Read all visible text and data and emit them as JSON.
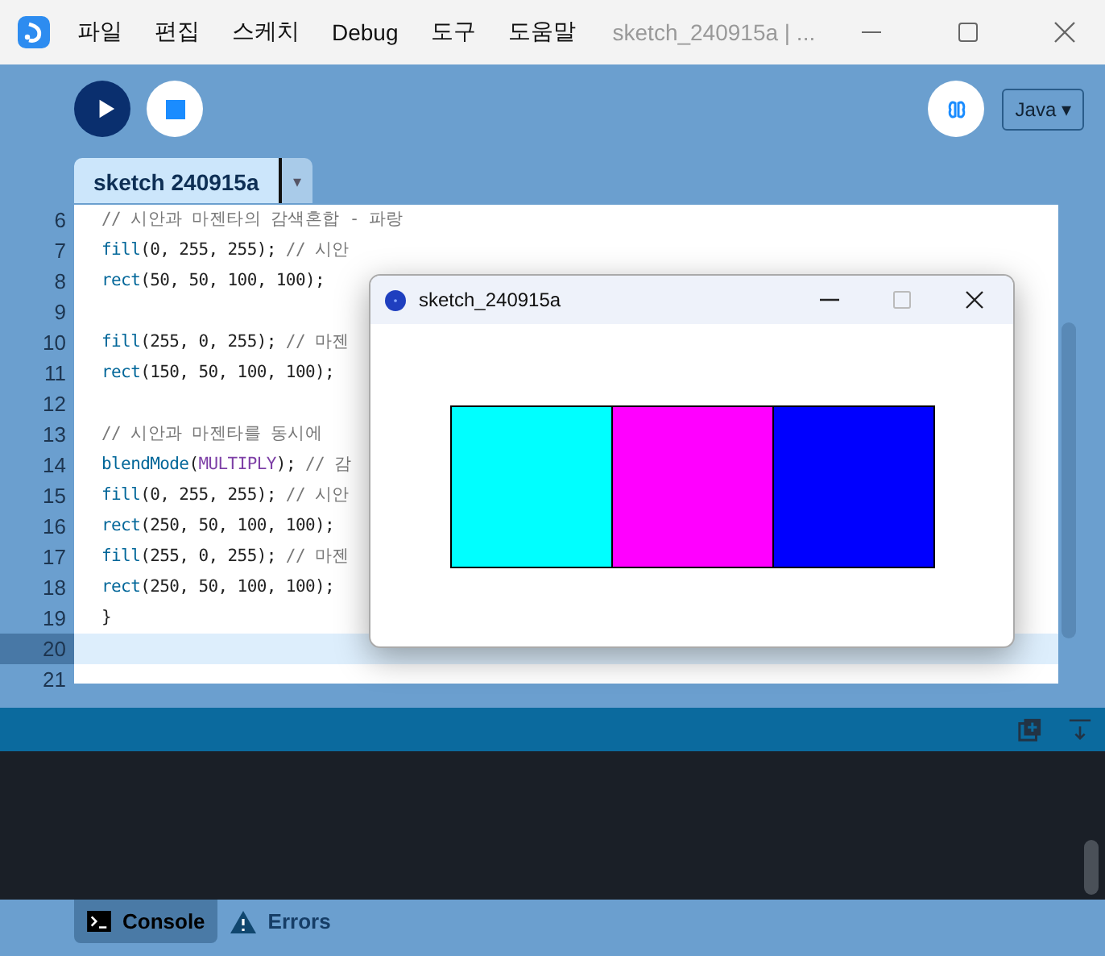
{
  "menu": [
    "파일",
    "편집",
    "스케치",
    "Debug",
    "도구",
    "도움말"
  ],
  "window": {
    "title": "sketch_240915a | ..."
  },
  "mode": "Java ▾",
  "tabs": [
    {
      "label": "sketch 240915a",
      "selected": true
    }
  ],
  "tab_menu": "▾",
  "editor": {
    "lines": [
      {
        "number": "6",
        "segments": [
          {
            "kind": "comment",
            "text": "// 시안과 마젠타의 감색혼합 - 파랑"
          }
        ]
      },
      {
        "number": "7",
        "segments": [
          {
            "kind": "fn",
            "text": "fill"
          },
          {
            "kind": "plain",
            "text": "(0, 255, 255); "
          },
          {
            "kind": "comment",
            "text": "// 시안"
          }
        ]
      },
      {
        "number": "8",
        "segments": [
          {
            "kind": "fn",
            "text": "rect"
          },
          {
            "kind": "plain",
            "text": "(50, 50, 100, 100);"
          }
        ]
      },
      {
        "number": "9",
        "current": false
      },
      {
        "number": "10",
        "segments": [
          {
            "kind": "fn",
            "text": "fill"
          },
          {
            "kind": "plain",
            "text": "(255, 0, 255); "
          },
          {
            "kind": "comment",
            "text": "// 마젠"
          }
        ]
      },
      {
        "number": "11",
        "segments": [
          {
            "kind": "fn",
            "text": "rect"
          },
          {
            "kind": "plain",
            "text": "(150, 50, 100, 100);"
          }
        ]
      },
      {
        "number": "12",
        "current": false
      },
      {
        "number": "13",
        "segments": [
          {
            "kind": "comment",
            "text": "// 시안과 마젠타를 동시에"
          }
        ]
      },
      {
        "number": "14",
        "segments": [
          {
            "kind": "fn",
            "text": "blendMode"
          },
          {
            "kind": "plain",
            "text": "("
          },
          {
            "kind": "const",
            "text": "MULTIPLY"
          },
          {
            "kind": "plain",
            "text": "); "
          },
          {
            "kind": "comment",
            "text": "// 감"
          }
        ]
      },
      {
        "number": "15",
        "segments": [
          {
            "kind": "fn",
            "text": "fill"
          },
          {
            "kind": "plain",
            "text": "(0, 255, 255); "
          },
          {
            "kind": "comment",
            "text": "// 시안"
          }
        ]
      },
      {
        "number": "16",
        "segments": [
          {
            "kind": "fn",
            "text": "rect"
          },
          {
            "kind": "plain",
            "text": "(250, 50, 100, 100);"
          }
        ]
      },
      {
        "number": "17",
        "segments": [
          {
            "kind": "fn",
            "text": "fill"
          },
          {
            "kind": "plain",
            "text": "(255, 0, 255); "
          },
          {
            "kind": "comment",
            "text": "// 마젠"
          }
        ]
      },
      {
        "number": "18",
        "segments": [
          {
            "kind": "fn",
            "text": "rect"
          },
          {
            "kind": "plain",
            "text": "(250, 50, 100, 100);"
          }
        ]
      },
      {
        "number": "19",
        "segments": [
          {
            "kind": "plain",
            "text": "}"
          }
        ]
      },
      {
        "number": "20",
        "current": true
      },
      {
        "number": "21",
        "current": false
      }
    ]
  },
  "sketch_window": {
    "title": "sketch_240915a",
    "rects": [
      {
        "color": "#00ffff"
      },
      {
        "color": "#ff00ff"
      },
      {
        "color": "#0000ff"
      }
    ]
  },
  "console_tabs": [
    {
      "label": "Console",
      "selected": true,
      "kind": "console"
    },
    {
      "label": "Errors",
      "selected": false,
      "kind": "errors"
    }
  ]
}
